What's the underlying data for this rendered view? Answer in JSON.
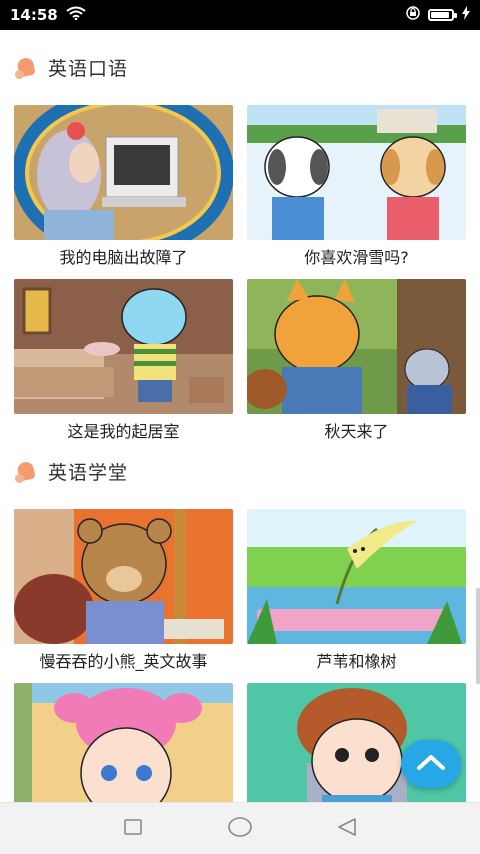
{
  "status_bar": {
    "time": "14:58",
    "icons": [
      "wifi-icon",
      "lock-icon",
      "battery-icon"
    ]
  },
  "sections": [
    {
      "title": "英语口语",
      "icon": "bell-icon",
      "items": [
        {
          "caption": "我的电脑出故障了"
        },
        {
          "caption": "你喜欢滑雪吗?"
        },
        {
          "caption": "这是我的起居室"
        },
        {
          "caption": "秋天来了"
        }
      ]
    },
    {
      "title": "英语学堂",
      "icon": "bell-icon",
      "items": [
        {
          "caption": "慢吞吞的小熊_英文故事"
        },
        {
          "caption": "芦苇和橡树"
        }
      ]
    }
  ],
  "colors": {
    "accent": "#28a7e6",
    "section_icon": "#f39b6d"
  },
  "nav_bar": {
    "buttons": [
      "recent-apps-icon",
      "home-icon",
      "back-icon"
    ]
  }
}
